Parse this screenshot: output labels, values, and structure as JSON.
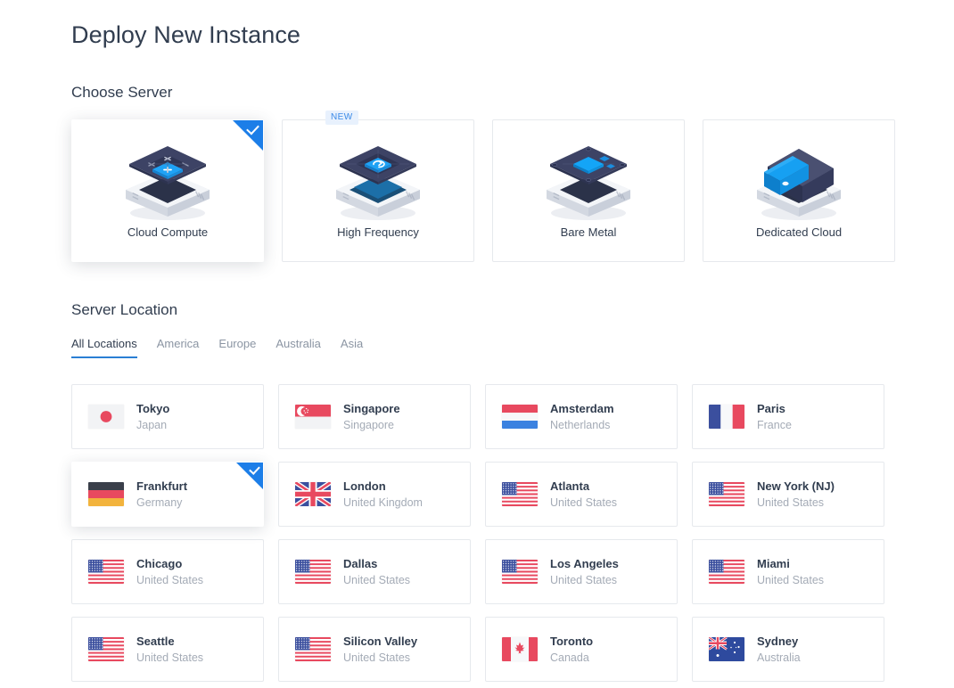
{
  "page": {
    "title": "Deploy New Instance"
  },
  "server_section": {
    "title": "Choose Server",
    "cards": [
      {
        "label": "Cloud Compute",
        "art": "cloud-compute-art",
        "selected": true,
        "badge": null
      },
      {
        "label": "High Frequency",
        "art": "high-frequency-art",
        "selected": false,
        "badge": "NEW"
      },
      {
        "label": "Bare Metal",
        "art": "bare-metal-art",
        "selected": false,
        "badge": null
      },
      {
        "label": "Dedicated Cloud",
        "art": "dedicated-cloud-art",
        "selected": false,
        "badge": null
      }
    ]
  },
  "location_section": {
    "title": "Server Location",
    "tabs": [
      {
        "label": "All Locations",
        "active": true
      },
      {
        "label": "America",
        "active": false
      },
      {
        "label": "Europe",
        "active": false
      },
      {
        "label": "Australia",
        "active": false
      },
      {
        "label": "Asia",
        "active": false
      }
    ],
    "locations": [
      {
        "city": "Tokyo",
        "country": "Japan",
        "flag": "flag-jp",
        "selected": false
      },
      {
        "city": "Singapore",
        "country": "Singapore",
        "flag": "flag-sg",
        "selected": false
      },
      {
        "city": "Amsterdam",
        "country": "Netherlands",
        "flag": "flag-nl",
        "selected": false
      },
      {
        "city": "Paris",
        "country": "France",
        "flag": "flag-fr",
        "selected": false
      },
      {
        "city": "Frankfurt",
        "country": "Germany",
        "flag": "flag-de",
        "selected": true
      },
      {
        "city": "London",
        "country": "United Kingdom",
        "flag": "flag-gb",
        "selected": false
      },
      {
        "city": "Atlanta",
        "country": "United States",
        "flag": "flag-us",
        "selected": false
      },
      {
        "city": "New York (NJ)",
        "country": "United States",
        "flag": "flag-us",
        "selected": false
      },
      {
        "city": "Chicago",
        "country": "United States",
        "flag": "flag-us",
        "selected": false
      },
      {
        "city": "Dallas",
        "country": "United States",
        "flag": "flag-us",
        "selected": false
      },
      {
        "city": "Los Angeles",
        "country": "United States",
        "flag": "flag-us",
        "selected": false
      },
      {
        "city": "Miami",
        "country": "United States",
        "flag": "flag-us",
        "selected": false
      },
      {
        "city": "Seattle",
        "country": "United States",
        "flag": "flag-us",
        "selected": false
      },
      {
        "city": "Silicon Valley",
        "country": "United States",
        "flag": "flag-us",
        "selected": false
      },
      {
        "city": "Toronto",
        "country": "Canada",
        "flag": "flag-ca",
        "selected": false
      },
      {
        "city": "Sydney",
        "country": "Australia",
        "flag": "flag-au",
        "selected": false
      }
    ]
  },
  "colors": {
    "accent": "#1c7ee8",
    "tab_active_underline": "#2a7fd4",
    "badge_bg": "#e8f1fd",
    "badge_text": "#3b8ae8",
    "text_primary": "#313d4f",
    "text_muted": "#a4abb6",
    "card_border": "#e6e9ed"
  }
}
